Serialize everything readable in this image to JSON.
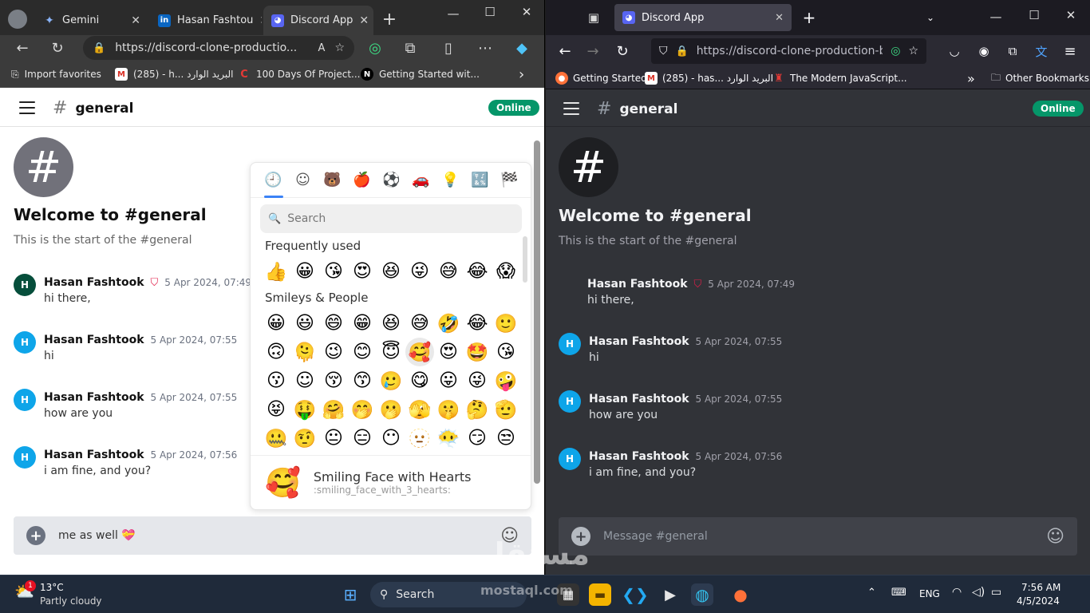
{
  "left_browser": {
    "tabs": [
      {
        "label": "Gemini",
        "close": "✕"
      },
      {
        "label": "Hasan Fashtou",
        "close": "✕"
      },
      {
        "label": "Discord App",
        "close": "✕"
      }
    ],
    "new_tab": "+",
    "url": "https://discord-clone-productio...",
    "bookmarks": [
      {
        "label": "Import favorites"
      },
      {
        "label": "(285) - h... البريد الوارد"
      },
      {
        "label": "100 Days Of Project..."
      },
      {
        "label": "Getting Started wit..."
      }
    ],
    "bookmarks_more": "›"
  },
  "right_browser": {
    "tab": {
      "label": "Discord App",
      "close": "✕"
    },
    "new_tab": "+",
    "url": "https://discord-clone-production-b7",
    "bookmarks": [
      {
        "label": "Getting Started"
      },
      {
        "label": "(285) - has... البريد الوارد"
      },
      {
        "label": "The Modern JavaScript..."
      }
    ],
    "bookmarks_more": "»",
    "other_bookmarks": "Other Bookmarks"
  },
  "discord": {
    "channel": "general",
    "hash": "#",
    "status": "Online",
    "welcome_title": "Welcome to #general",
    "welcome_sub": "This is the start of the #general",
    "messages": [
      {
        "avatar": "H",
        "name": "Hasan Fashtook",
        "time": "5 Apr 2024, 07:49",
        "text": "hi there,",
        "shield": "⛉"
      },
      {
        "avatar": "H",
        "name": "Hasan Fashtook",
        "time": "5 Apr 2024, 07:55",
        "text": "hi"
      },
      {
        "avatar": "H",
        "name": "Hasan Fashtook",
        "time": "5 Apr 2024, 07:55",
        "text": "how are you"
      },
      {
        "avatar": "H",
        "name": "Hasan Fashtook",
        "time": "5 Apr 2024, 07:56",
        "text": "i am fine, and you?"
      }
    ],
    "composer_left_value": "me as well  💝",
    "composer_right_placeholder": "Message #general",
    "plus": "+",
    "emoji_button": "☺"
  },
  "emoji_picker": {
    "categories": [
      "🕘",
      "☺",
      "🐻",
      "🍎",
      "⚽",
      "🚗",
      "💡",
      "🔣",
      "🏁"
    ],
    "search_placeholder": "Search",
    "search_icon": "🔍",
    "frequently_used_label": "Frequently used",
    "frequently_used": [
      "👍",
      "😀",
      "😘",
      "😍",
      "😆",
      "😜",
      "😅",
      "😂",
      "😱"
    ],
    "smileys_label": "Smileys & People",
    "smileys": [
      "😀",
      "😃",
      "😄",
      "😁",
      "😆",
      "😅",
      "🤣",
      "😂",
      "🙂",
      "🙃",
      "🫠",
      "😉",
      "😊",
      "😇",
      "🥰",
      "😍",
      "🤩",
      "😘",
      "😗",
      "☺",
      "😚",
      "😙",
      "🥲",
      "😋",
      "😛",
      "😜",
      "🤪",
      "😝",
      "🤑",
      "🤗",
      "🤭",
      "🫢",
      "🫣",
      "🤫",
      "🤔",
      "🫡",
      "🤐",
      "🤨",
      "😐",
      "😑",
      "😶",
      "🫥",
      "😶‍🌫️",
      "😏",
      "😒"
    ],
    "preview_emoji": "🥰",
    "preview_name": "Smiling Face with Hearts",
    "preview_shortcode": ":smiling_face_with_3_hearts:"
  },
  "taskbar": {
    "weather_temp": "13°C",
    "weather_desc": "Partly cloudy",
    "weather_badge": "1",
    "search_label": "Search",
    "lang": "ENG",
    "time": "7:56 AM",
    "date": "4/5/2024"
  },
  "watermark": {
    "arabic": "مستقل",
    "latin": "mostaql.com"
  },
  "colors": {
    "discord_green": "#059669",
    "avatar_blue": "#0ea5e9",
    "avatar_dark_green": "#064e3b",
    "accent_blue": "#3b82f6",
    "dark_bg": "#313338"
  }
}
